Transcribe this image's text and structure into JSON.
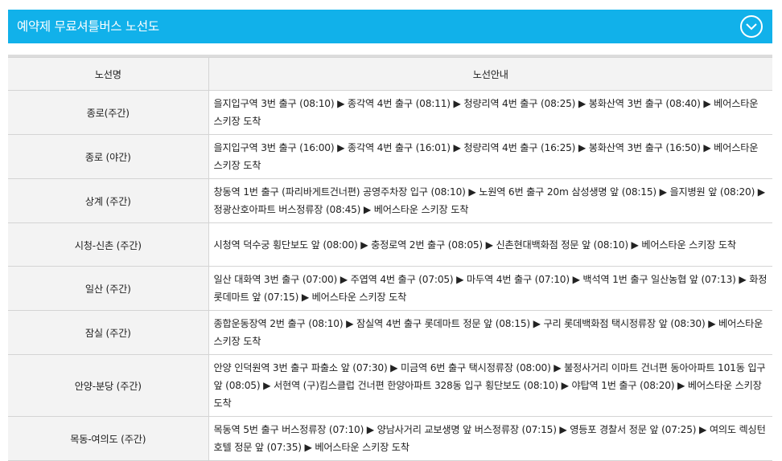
{
  "header": {
    "title": "예약제 무료셔틀버스 노선도",
    "toggle_icon": "chevron-down-circle-icon"
  },
  "table": {
    "columns": [
      "노선명",
      "노선안내"
    ],
    "rows": [
      {
        "name": "종로(주간)",
        "route": "을지입구역 3번 출구 (08:10) ▶ 종각역 4번 출구 (08:11) ▶ 청량리역 4번 출구 (08:25) ▶ 봉화산역 3번 출구 (08:40) ▶ 베어스타운 스키장 도착"
      },
      {
        "name": "종로 (야간)",
        "route": "을지입구역 3번 출구 (16:00) ▶ 종각역 4번 출구 (16:01) ▶ 청량리역 4번 출구 (16:25) ▶ 봉화산역 3번 출구 (16:50) ▶ 베어스타운 스키장 도착"
      },
      {
        "name": "상계 (주간)",
        "route": "창동역 1번 출구 (파리바게트건너편) 공영주차장 입구 (08:10) ▶ 노원역 6번 출구 20m 삼성생명 앞 (08:15) ▶ 을지병원 앞 (08:20) ▶ 정광산호아파트 버스정류장 (08:45) ▶ 베어스타운 스키장 도착"
      },
      {
        "name": "시청-신촌 (주간)",
        "route": "시청역 덕수궁 횡단보도 앞 (08:00) ▶ 충정로역 2번 출구 (08:05) ▶ 신촌현대백화점 정문 앞 (08:10) ▶ 베어스타운 스키장 도착"
      },
      {
        "name": "일산 (주간)",
        "route": "일산 대화역 3번 출구 (07:00) ▶ 주엽역 4번 출구 (07:05) ▶ 마두역 4번 출구 (07:10) ▶ 백석역 1번 출구 일산농협 앞 (07:13) ▶ 화정롯데마트 앞 (07:15) ▶ 베어스타운 스키장 도착"
      },
      {
        "name": "잠실 (주간)",
        "route": "종합운동장역 2번 출구 (08:10) ▶ 잠실역 4번 출구 롯데마트 정문 앞 (08:15) ▶ 구리 롯데백화점 택시정류장 앞 (08:30) ▶ 베어스타운 스키장 도착"
      },
      {
        "name": "안양-분당 (주간)",
        "route": "안양 인덕원역 3번 출구 파출소 앞 (07:30) ▶ 미금역 6번 출구 택시정류장 (08:00) ▶ 불정사거리 이마트 건너편 동아아파트 101동 입구 앞 (08:05) ▶ 서현역 (구)킴스클럽 건너편 한양아파트 328동 입구 횡단보도 (08:10) ▶ 야탑역 1번 출구 (08:20) ▶ 베어스타운 스키장 도착"
      },
      {
        "name": "목동-여의도 (주간)",
        "route": "목동역 5번 출구 버스정류장 (07:10) ▶ 양남사거리 교보생명 앞 버스정류장 (07:15) ▶ 영등포 경찰서 정문 앞 (07:25) ▶ 여의도 렉싱턴호텔 정문 앞 (07:35) ▶ 베어스타운 스키장 도착"
      }
    ]
  },
  "colors": {
    "header_bg": "#11b1ea",
    "header_text": "#ffffff",
    "cell_header_bg": "#f3f3f3",
    "border": "#d4d4d4"
  }
}
